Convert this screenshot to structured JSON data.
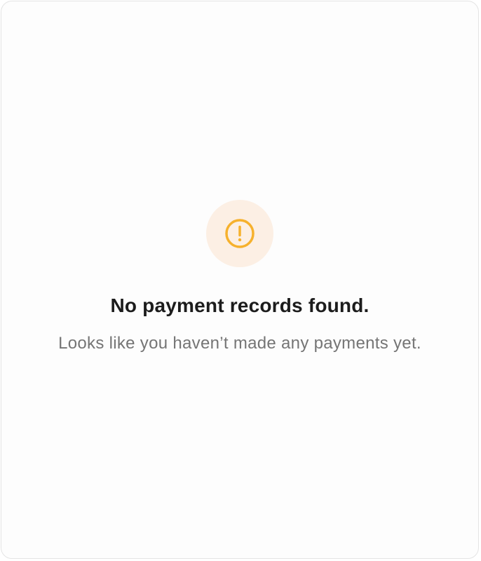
{
  "empty_state": {
    "icon": "alert-circle-icon",
    "icon_color": "#F6B12D",
    "icon_background": "#FCEFE4",
    "title": "No payment records found.",
    "message": "Looks like you haven’t made any payments yet."
  }
}
